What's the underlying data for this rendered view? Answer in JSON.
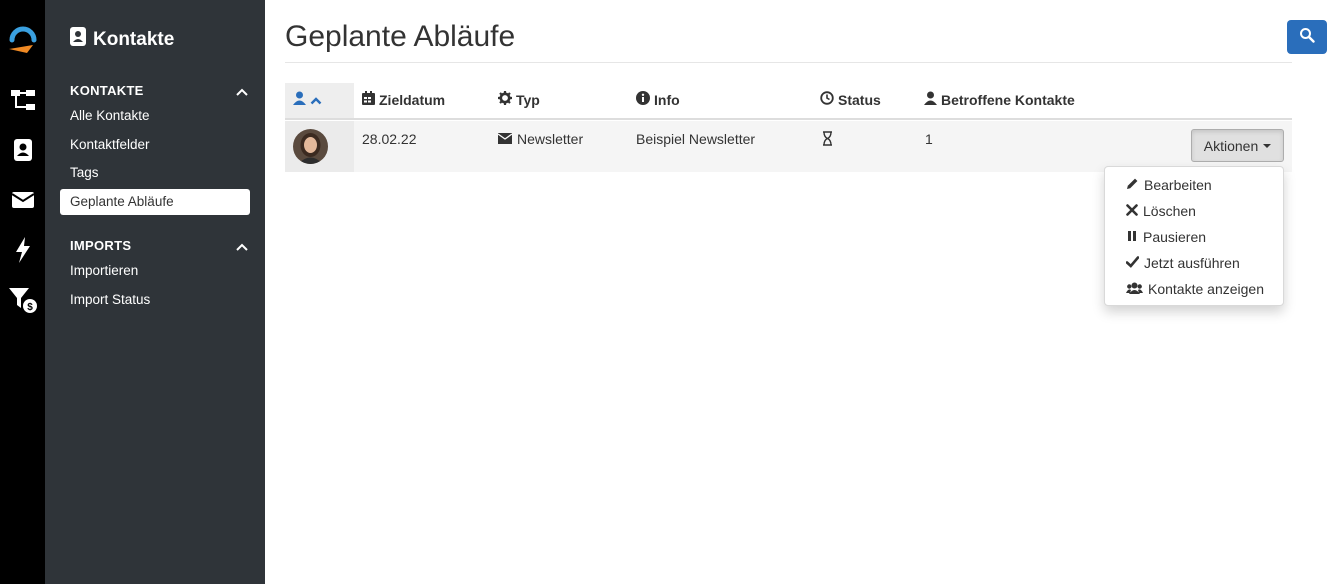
{
  "rail": {
    "icons": [
      "app-logo-icon",
      "workflow-icon",
      "contacts-icon",
      "mail-icon",
      "bolt-icon",
      "filter-dollar-icon"
    ]
  },
  "sidebar": {
    "title": "Kontakte",
    "sections": [
      {
        "label": "KONTAKTE",
        "items": [
          "Alle Kontakte",
          "Kontaktfelder",
          "Tags",
          "Geplante Abläufe"
        ]
      },
      {
        "label": "IMPORTS",
        "items": [
          "Importieren",
          "Import Status"
        ]
      }
    ],
    "active_item": "Geplante Abläufe"
  },
  "main": {
    "title": "Geplante Abläufe",
    "table": {
      "headers": [
        "",
        "Zieldatum",
        "Typ",
        "Info",
        "Status",
        "Betroffene Kontakte"
      ],
      "rows": [
        {
          "date": "28.02.22",
          "type": "Newsletter",
          "info": "Beispiel Newsletter",
          "status_icon": "hourglass-icon",
          "count": "1"
        }
      ]
    },
    "actions_button": "Aktionen",
    "actions_menu": [
      "Bearbeiten",
      "Löschen",
      "Pausieren",
      "Jetzt ausführen",
      "Kontakte anzeigen"
    ]
  },
  "colors": {
    "rail_bg": "#000000",
    "sidebar_bg": "#2f3439",
    "primary": "#2a6ebb",
    "logo_blue": "#3aa0e0",
    "logo_orange": "#f08a24"
  }
}
